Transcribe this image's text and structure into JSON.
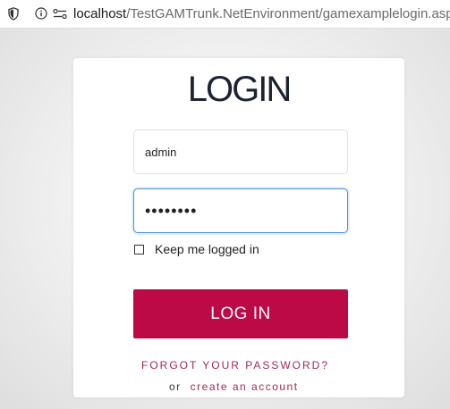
{
  "browser": {
    "url_host": "localhost",
    "url_path": "/TestGAMTrunk.NetEnvironment/gamexamplelogin.aspx",
    "icons": [
      "shield-icon",
      "info-icon",
      "permissions-icon"
    ]
  },
  "login": {
    "title": "LOGIN",
    "username_value": "admin",
    "password_value": "••••••••",
    "remember_label": "Keep me logged in",
    "remember_checked": false,
    "submit_label": "LOG IN",
    "forgot_label": "FORGOT YOUR PASSWORD?",
    "or_text": "or",
    "create_account_label": "create an account"
  },
  "colors": {
    "accent": "#bb0a45",
    "link": "#a2284f",
    "title": "#1d2233",
    "focus_border": "#4a90d9"
  }
}
